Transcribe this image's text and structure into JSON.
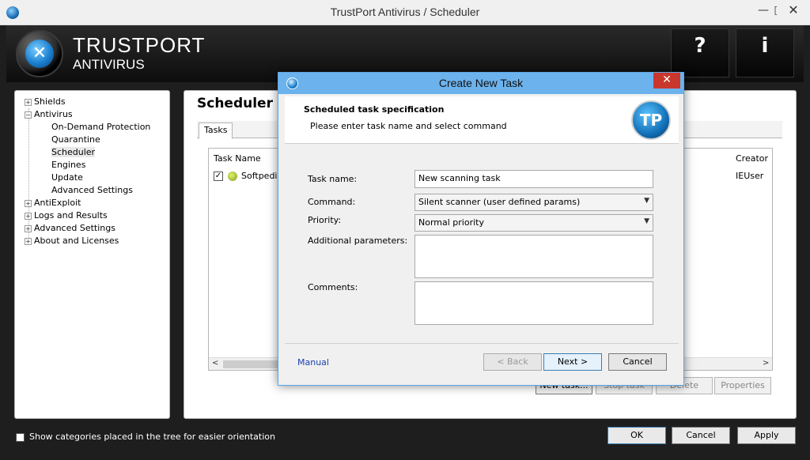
{
  "window": {
    "title": "TrustPort Antivirus / Scheduler",
    "minimize": "—",
    "maximize": "□",
    "close": "✕"
  },
  "header": {
    "brand_line1": "TRUSTPORT",
    "brand_line2": "ANTIVIRUS",
    "help_glyph": "?",
    "about_glyph": "i"
  },
  "tree": {
    "items": [
      {
        "label": "Shields",
        "expander": "+"
      },
      {
        "label": "Antivirus",
        "expander": "−"
      },
      {
        "label": "On-Demand Protection"
      },
      {
        "label": "Quarantine"
      },
      {
        "label": "Scheduler"
      },
      {
        "label": "Engines"
      },
      {
        "label": "Update"
      },
      {
        "label": "Advanced Settings"
      },
      {
        "label": "AntiExploit",
        "expander": "+"
      },
      {
        "label": "Logs and Results",
        "expander": "+"
      },
      {
        "label": "Advanced Settings",
        "expander": "+"
      },
      {
        "label": "About and Licenses",
        "expander": "+"
      }
    ]
  },
  "main": {
    "title": "Scheduler",
    "tab": "Tasks",
    "columns": {
      "task_name": "Task Name",
      "creator": "Creator"
    },
    "row": {
      "checked": "✓",
      "name": "Softpedia",
      "creator": "IEUser"
    },
    "scroll_left": "<",
    "scroll_right": ">",
    "buttons": {
      "new_task": "New task...",
      "stop_task": "Stop task",
      "delete": "Delete",
      "properties": "Properties"
    }
  },
  "bottom": {
    "checkbox_checked": "✓",
    "checkbox_label": "Show categories placed in the tree for easier orientation",
    "ok": "OK",
    "cancel": "Cancel",
    "apply": "Apply"
  },
  "dialog": {
    "title": "Create New Task",
    "close": "✕",
    "heading": "Scheduled task specification",
    "subheading": "Please enter task name and select command",
    "logo_text": "TP",
    "labels": {
      "task_name": "Task name:",
      "command": "Command:",
      "priority": "Priority:",
      "additional": "Additional parameters:",
      "comments": "Comments:"
    },
    "values": {
      "task_name": "New scanning task",
      "command": "Silent scanner (user defined params)",
      "priority": "Normal priority",
      "additional": "",
      "comments": ""
    },
    "caret": "▼",
    "manual": "Manual",
    "back": "< Back",
    "next": "Next >",
    "cancel": "Cancel"
  }
}
